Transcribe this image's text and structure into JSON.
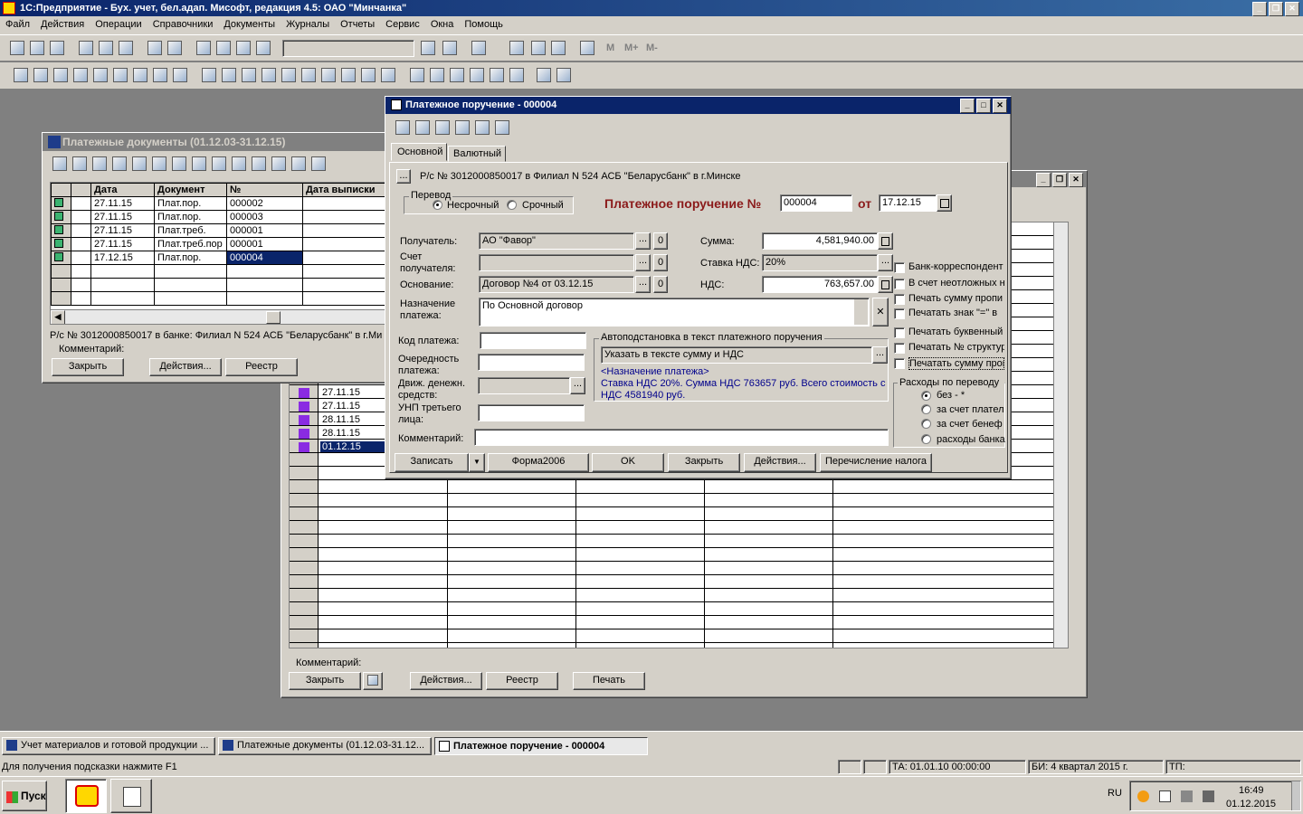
{
  "app": {
    "title": "1С:Предприятие - Бух. учет, бел.адап. Мисофт, редакция 4.5: ОАО \"Минчанка\""
  },
  "menu": [
    "Файл",
    "Действия",
    "Операции",
    "Справочники",
    "Документы",
    "Журналы",
    "Отчеты",
    "Сервис",
    "Окна",
    "Помощь"
  ],
  "toolbar": {
    "calc_labels": [
      "M",
      "M+",
      "M-"
    ]
  },
  "journal": {
    "title": "Платежные документы (01.12.03-31.12.15)",
    "columns": [
      "Дата",
      "Документ",
      "№",
      "Дата выписки"
    ],
    "rows": [
      {
        "date": "27.11.15",
        "doc": "Плат.пор.",
        "num": "000002"
      },
      {
        "date": "27.11.15",
        "doc": "Плат.пор.",
        "num": "000003"
      },
      {
        "date": "27.11.15",
        "doc": "Плат.треб.",
        "num": "000001"
      },
      {
        "date": "27.11.15",
        "doc": "Плат.треб.пор",
        "num": "000001"
      },
      {
        "date": "17.12.15",
        "doc": "Плат.пор.",
        "num": "000004"
      }
    ],
    "account_info": "Р/с № 3012000850017 в банке: Филиал N 524 АСБ \"Беларусбанк\" в г.Ми",
    "comment_label": "Комментарий:",
    "buttons": {
      "close": "Закрыть",
      "actions": "Действия...",
      "registry": "Реестр"
    }
  },
  "back_window": {
    "dates": [
      "27.11.15",
      "27.11.15",
      "28.11.15",
      "28.11.15",
      "01.12.15"
    ],
    "comment_label": "Комментарий:",
    "buttons": {
      "close": "Закрыть",
      "actions": "Действия...",
      "registry": "Реестр",
      "print": "Печать"
    }
  },
  "order": {
    "title": "Платежное поручение - 000004",
    "tabs": [
      "Основной",
      "Валютный"
    ],
    "account": "Р/с № 3012000850017 в Филиал N 524 АСБ \"Беларусбанк\" в г.Минске",
    "transfer_label": "Перевод",
    "transfer_options": [
      "Несрочный",
      "Срочный"
    ],
    "heading": "Платежное поручение №",
    "number": "000004",
    "from_label": "от",
    "date": "17.12.15",
    "recipient_label": "Получатель:",
    "recipient": "АО \"Фавор\"",
    "recipient_account_label": [
      "Счет",
      "получателя:"
    ],
    "basis_label": "Основание:",
    "basis": "Договор №4 от 03.12.15",
    "purpose_label": [
      "Назначение",
      "платежа:"
    ],
    "purpose": "По Основной договор",
    "sum_label": "Сумма:",
    "sum": "4,581,940.00",
    "vat_rate_label": "Ставка НДС:",
    "vat_rate": "20%",
    "vat_label": "НДС:",
    "vat": "763,657.00",
    "zero": "0",
    "ellipsis": "...",
    "checkboxes": [
      "Банк-корреспондент",
      "В счет неотложных н",
      "Печать сумму пропи",
      "Печатать знак \"=\" в",
      "Печатать буквенный",
      "Печатать № структур",
      "Печатать сумму проп"
    ],
    "code_label": "Код платежа:",
    "priority_label": [
      "Очередность",
      "платежа:"
    ],
    "cashflow_label": [
      "Движ. денежн.",
      "средств:"
    ],
    "unp_label": [
      "УНП третьего",
      "лица:"
    ],
    "comment_label": "Комментарий:",
    "auto_label": "Автоподстановка в текст платежного поручения",
    "auto_value": "Указать в тексте сумму и НДС",
    "auto_text": [
      "<Назначение платежа>",
      "Ставка НДС 20%. Сумма НДС 763657 руб. Всего стоимость с",
      "НДС 4581940 руб."
    ],
    "expense_label": "Расходы по переводу",
    "expense_options": [
      "без - *",
      "за счет плател",
      "за счет бенеф",
      "расходы банка"
    ],
    "buttons": {
      "save": "Записать",
      "form": "Форма2006",
      "ok": "OK",
      "close": "Закрыть",
      "actions": "Действия...",
      "tax": "Перечисление налога"
    }
  },
  "taskbar_windows": [
    "Учет материалов и готовой продукции ...",
    "Платежные документы (01.12.03-31.12...",
    "Платежное поручение - 000004"
  ],
  "status": {
    "hint": "Для получения подсказки нажмите F1",
    "ta": "ТА: 01.01.10  00:00:00",
    "bi": "БИ: 4 квартал 2015 г.",
    "tp": "ТП:"
  },
  "os": {
    "start": "Пуск",
    "lang": "RU",
    "time": "16:49",
    "date": "01.12.2015"
  }
}
